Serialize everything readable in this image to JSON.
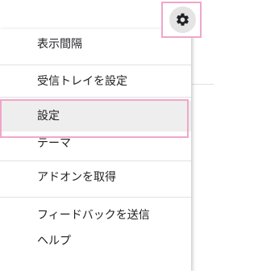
{
  "toolbar": {
    "settings_icon": "gear-icon"
  },
  "menu": {
    "items": [
      {
        "label": "表示間隔"
      },
      {
        "label": "受信トレイを設定"
      },
      {
        "label": "設定"
      },
      {
        "label": "テーマ"
      },
      {
        "label": "アドオンを取得"
      },
      {
        "label": "フィードバックを送信"
      },
      {
        "label": "ヘルプ"
      }
    ]
  },
  "colors": {
    "highlight": "#f0a6c8",
    "hover_background": "#eeeeee",
    "gear_background": "#e4e4e4"
  }
}
